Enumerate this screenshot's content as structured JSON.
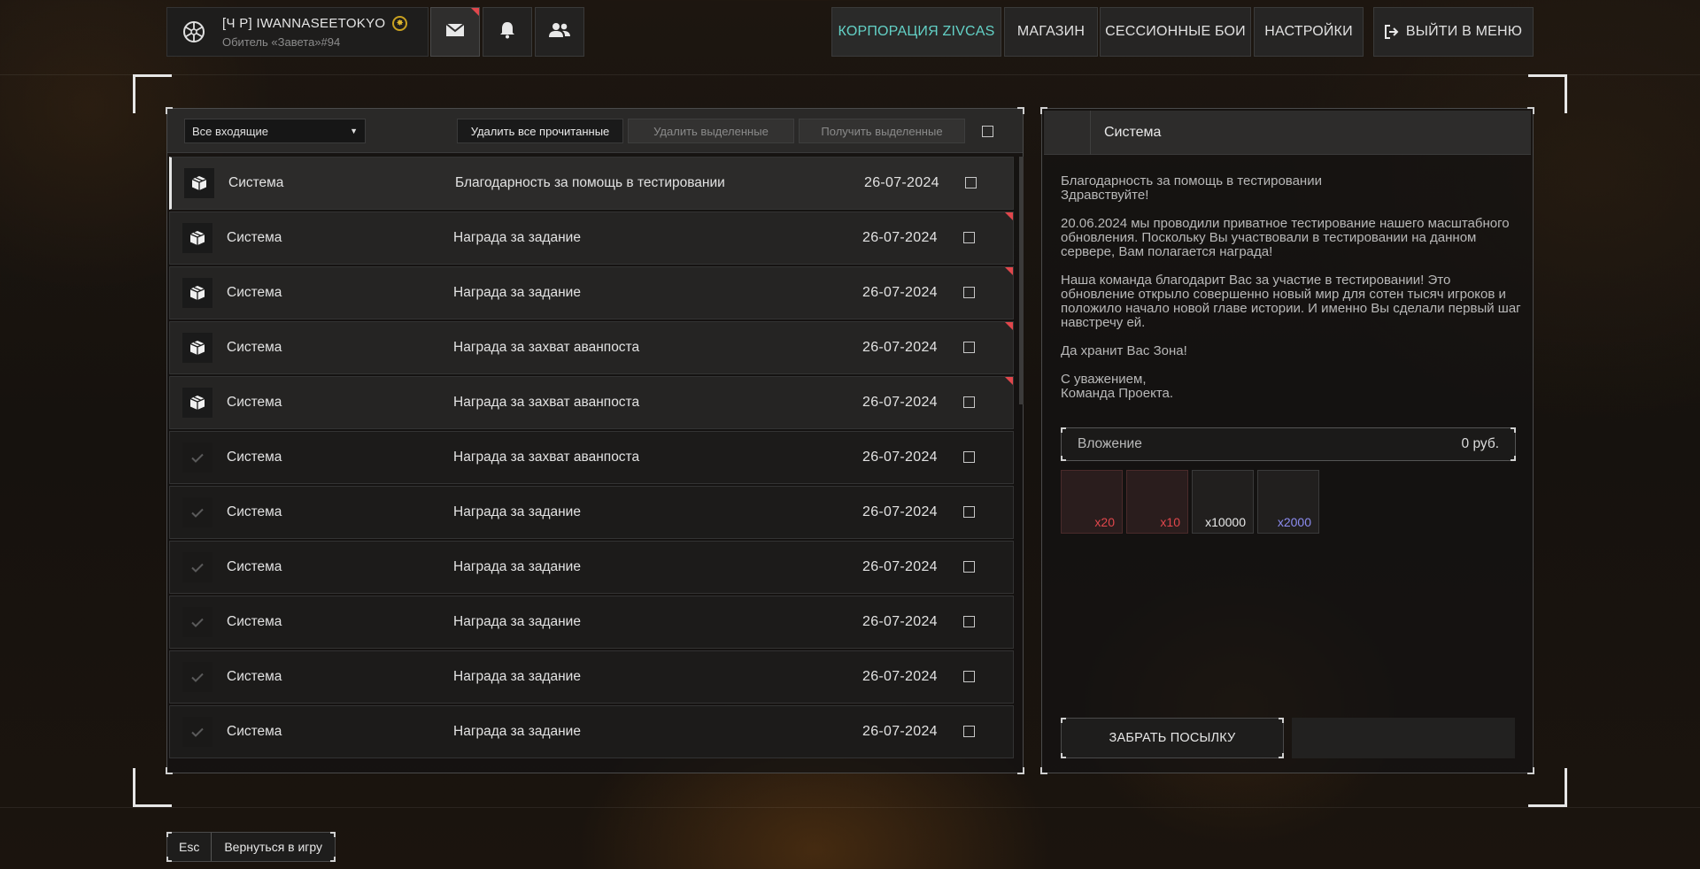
{
  "profile": {
    "name": "[Ч  P] IWANNASEETOKYO",
    "badge_icon": "gold-sun-badge",
    "subtitle": "Обитель «Завета»#94"
  },
  "top_icons": [
    {
      "name": "mail-icon",
      "active": true,
      "has_new": true
    },
    {
      "name": "bell-icon",
      "active": false,
      "has_new": false
    },
    {
      "name": "friends-icon",
      "active": false,
      "has_new": false
    }
  ],
  "nav": {
    "corporation": "КОРПОРАЦИЯ ZIVCAS",
    "shop": "МАГАЗИН",
    "session_battles": "СЕССИОННЫЕ БОИ",
    "settings": "НАСТРОЙКИ",
    "exit": "ВЫЙТИ В МЕНЮ"
  },
  "colors": {
    "accent": "#63d1c6",
    "new_marker": "#e0474c",
    "item_red": "#e0474c",
    "item_blue": "#8c8cf0"
  },
  "toolbar": {
    "filter": "Все входящие",
    "delete_read": "Удалить все прочитанные",
    "delete_selected": "Удалить выделенные",
    "receive_selected": "Получить выделенные"
  },
  "messages": [
    {
      "sender": "Система",
      "subject": "Благодарность за помощь в тестировании",
      "date": "26-07-2024",
      "status": "box",
      "is_new": false,
      "selected": true
    },
    {
      "sender": "Система",
      "subject": "Награда за задание",
      "date": "26-07-2024",
      "status": "box",
      "is_new": true,
      "selected": false
    },
    {
      "sender": "Система",
      "subject": "Награда за задание",
      "date": "26-07-2024",
      "status": "box",
      "is_new": true,
      "selected": false
    },
    {
      "sender": "Система",
      "subject": "Награда за захват аванпоста",
      "date": "26-07-2024",
      "status": "box",
      "is_new": true,
      "selected": false
    },
    {
      "sender": "Система",
      "subject": "Награда за захват аванпоста",
      "date": "26-07-2024",
      "status": "box",
      "is_new": true,
      "selected": false
    },
    {
      "sender": "Система",
      "subject": "Награда за захват аванпоста",
      "date": "26-07-2024",
      "status": "check",
      "is_new": false,
      "selected": false
    },
    {
      "sender": "Система",
      "subject": "Награда за задание",
      "date": "26-07-2024",
      "status": "check",
      "is_new": false,
      "selected": false
    },
    {
      "sender": "Система",
      "subject": "Награда за задание",
      "date": "26-07-2024",
      "status": "check",
      "is_new": false,
      "selected": false
    },
    {
      "sender": "Система",
      "subject": "Награда за задание",
      "date": "26-07-2024",
      "status": "check",
      "is_new": false,
      "selected": false
    },
    {
      "sender": "Система",
      "subject": "Награда за задание",
      "date": "26-07-2024",
      "status": "check",
      "is_new": false,
      "selected": false
    },
    {
      "sender": "Система",
      "subject": "Награда за задание",
      "date": "26-07-2024",
      "status": "check",
      "is_new": false,
      "selected": false
    }
  ],
  "detail": {
    "sender": "Система",
    "paragraphs": [
      "Благодарность за помощь в тестировании\nЗдравствуйте!",
      "20.06.2024 мы проводили приватное тестирование нашего масштабного обновления. Поскольку Вы участвовали в тестировании на данном сервере, Вам полагается награда!",
      "Наша команда благодарит Вас за участие в тестировании! Это обновление открыло совершенно новый мир для сотен тысяч игроков и положило начало новой главе истории. И именно Вы сделали первый шаг навстречу ей.",
      "Да хранит Вас Зона!",
      "С уважением,\nКоманда Проекта."
    ],
    "attachment_label": "Вложение",
    "attachment_value": "0  руб.",
    "items": [
      {
        "qty": "x20",
        "color": "#e0474c",
        "tint": "red"
      },
      {
        "qty": "x10",
        "color": "#e0474c",
        "tint": "red"
      },
      {
        "qty": "x10000",
        "color": "#e8e8e8",
        "tint": "none"
      },
      {
        "qty": "x2000",
        "color": "#8c8cf0",
        "tint": "none"
      }
    ],
    "claim_button": "ЗАБРАТЬ ПОСЫЛКУ"
  },
  "footer": {
    "key": "Esc",
    "label": "Вернуться в игру"
  }
}
